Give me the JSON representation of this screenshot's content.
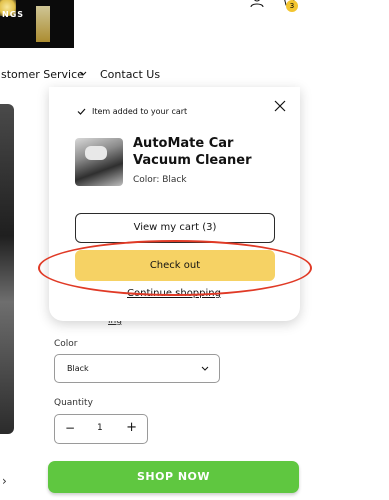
{
  "header": {
    "logo_text": "NGS",
    "cart_count": "3"
  },
  "nav": {
    "customer_service": "ustomer Service",
    "contact_us": "Contact Us"
  },
  "product_form": {
    "color_label": "Color",
    "color_value": "Black",
    "quantity_label": "Quantity",
    "quantity_minus": "−",
    "quantity_value": "1",
    "quantity_plus": "+",
    "shop_now": "SHOP NOW",
    "hidden_link": "ing"
  },
  "cart_popup": {
    "added_text": "Item added to your cart",
    "product_title": "AutoMate Car Vacuum Cleaner",
    "product_color": "Color: Black",
    "view_cart": "View my cart (3)",
    "checkout": "Check out",
    "continue_shopping": "Continue shopping"
  },
  "icons": {
    "account": "account-icon",
    "cart": "cart-icon",
    "close": "close-icon",
    "check": "check-icon",
    "chevron": "chevron-down-icon"
  },
  "colors": {
    "checkout_bg": "#f6d264",
    "shop_now_bg": "#5fc740",
    "highlight": "#e03a26",
    "badge": "#f3c530"
  }
}
